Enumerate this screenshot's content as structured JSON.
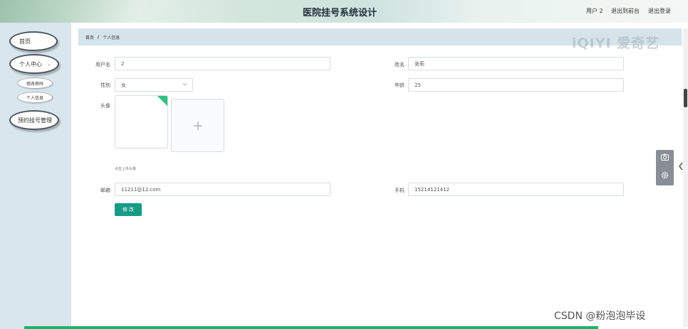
{
  "header": {
    "title": "医院挂号系统设计",
    "user": "用户 2",
    "back_to_front": "退出到前台",
    "logout": "退出登录"
  },
  "sidebar": {
    "items": [
      {
        "label": "首页"
      },
      {
        "label": "个人中心",
        "chevron": "⌄"
      },
      {
        "label": "修改密码"
      },
      {
        "label": "个人信息"
      },
      {
        "label": "预约挂号管理"
      }
    ]
  },
  "breadcrumb": {
    "home": "首页",
    "separator": "/",
    "current": "个人信息"
  },
  "watermark": "iQIYI 爱奇艺",
  "form": {
    "username_label": "用户名",
    "username_value": "2",
    "name_label": "姓名",
    "name_value": "张莉",
    "gender_label": "性别",
    "gender_value": "女",
    "age_label": "年龄",
    "age_value": "25",
    "avatar_label": "头像",
    "upload_hint": "点击上传头像",
    "email_label": "邮箱",
    "email_value": "11211@12.com",
    "phone_label": "手机",
    "phone_value": "15214121412",
    "submit_label": "修 改"
  },
  "footer_watermark": "CSDN @粉泡泡毕设",
  "colors": {
    "primary": "#169b85",
    "sidebar_bg": "#d9e6ed",
    "breadcrumb_bg": "#d5e3ea",
    "tag_green": "#2fc27e",
    "bottom_bar": "#1ab56a"
  },
  "icons": {
    "camera": "camera-icon",
    "settings": "gear-icon",
    "collapse": "chevron-left-icon",
    "add": "plus-icon"
  }
}
